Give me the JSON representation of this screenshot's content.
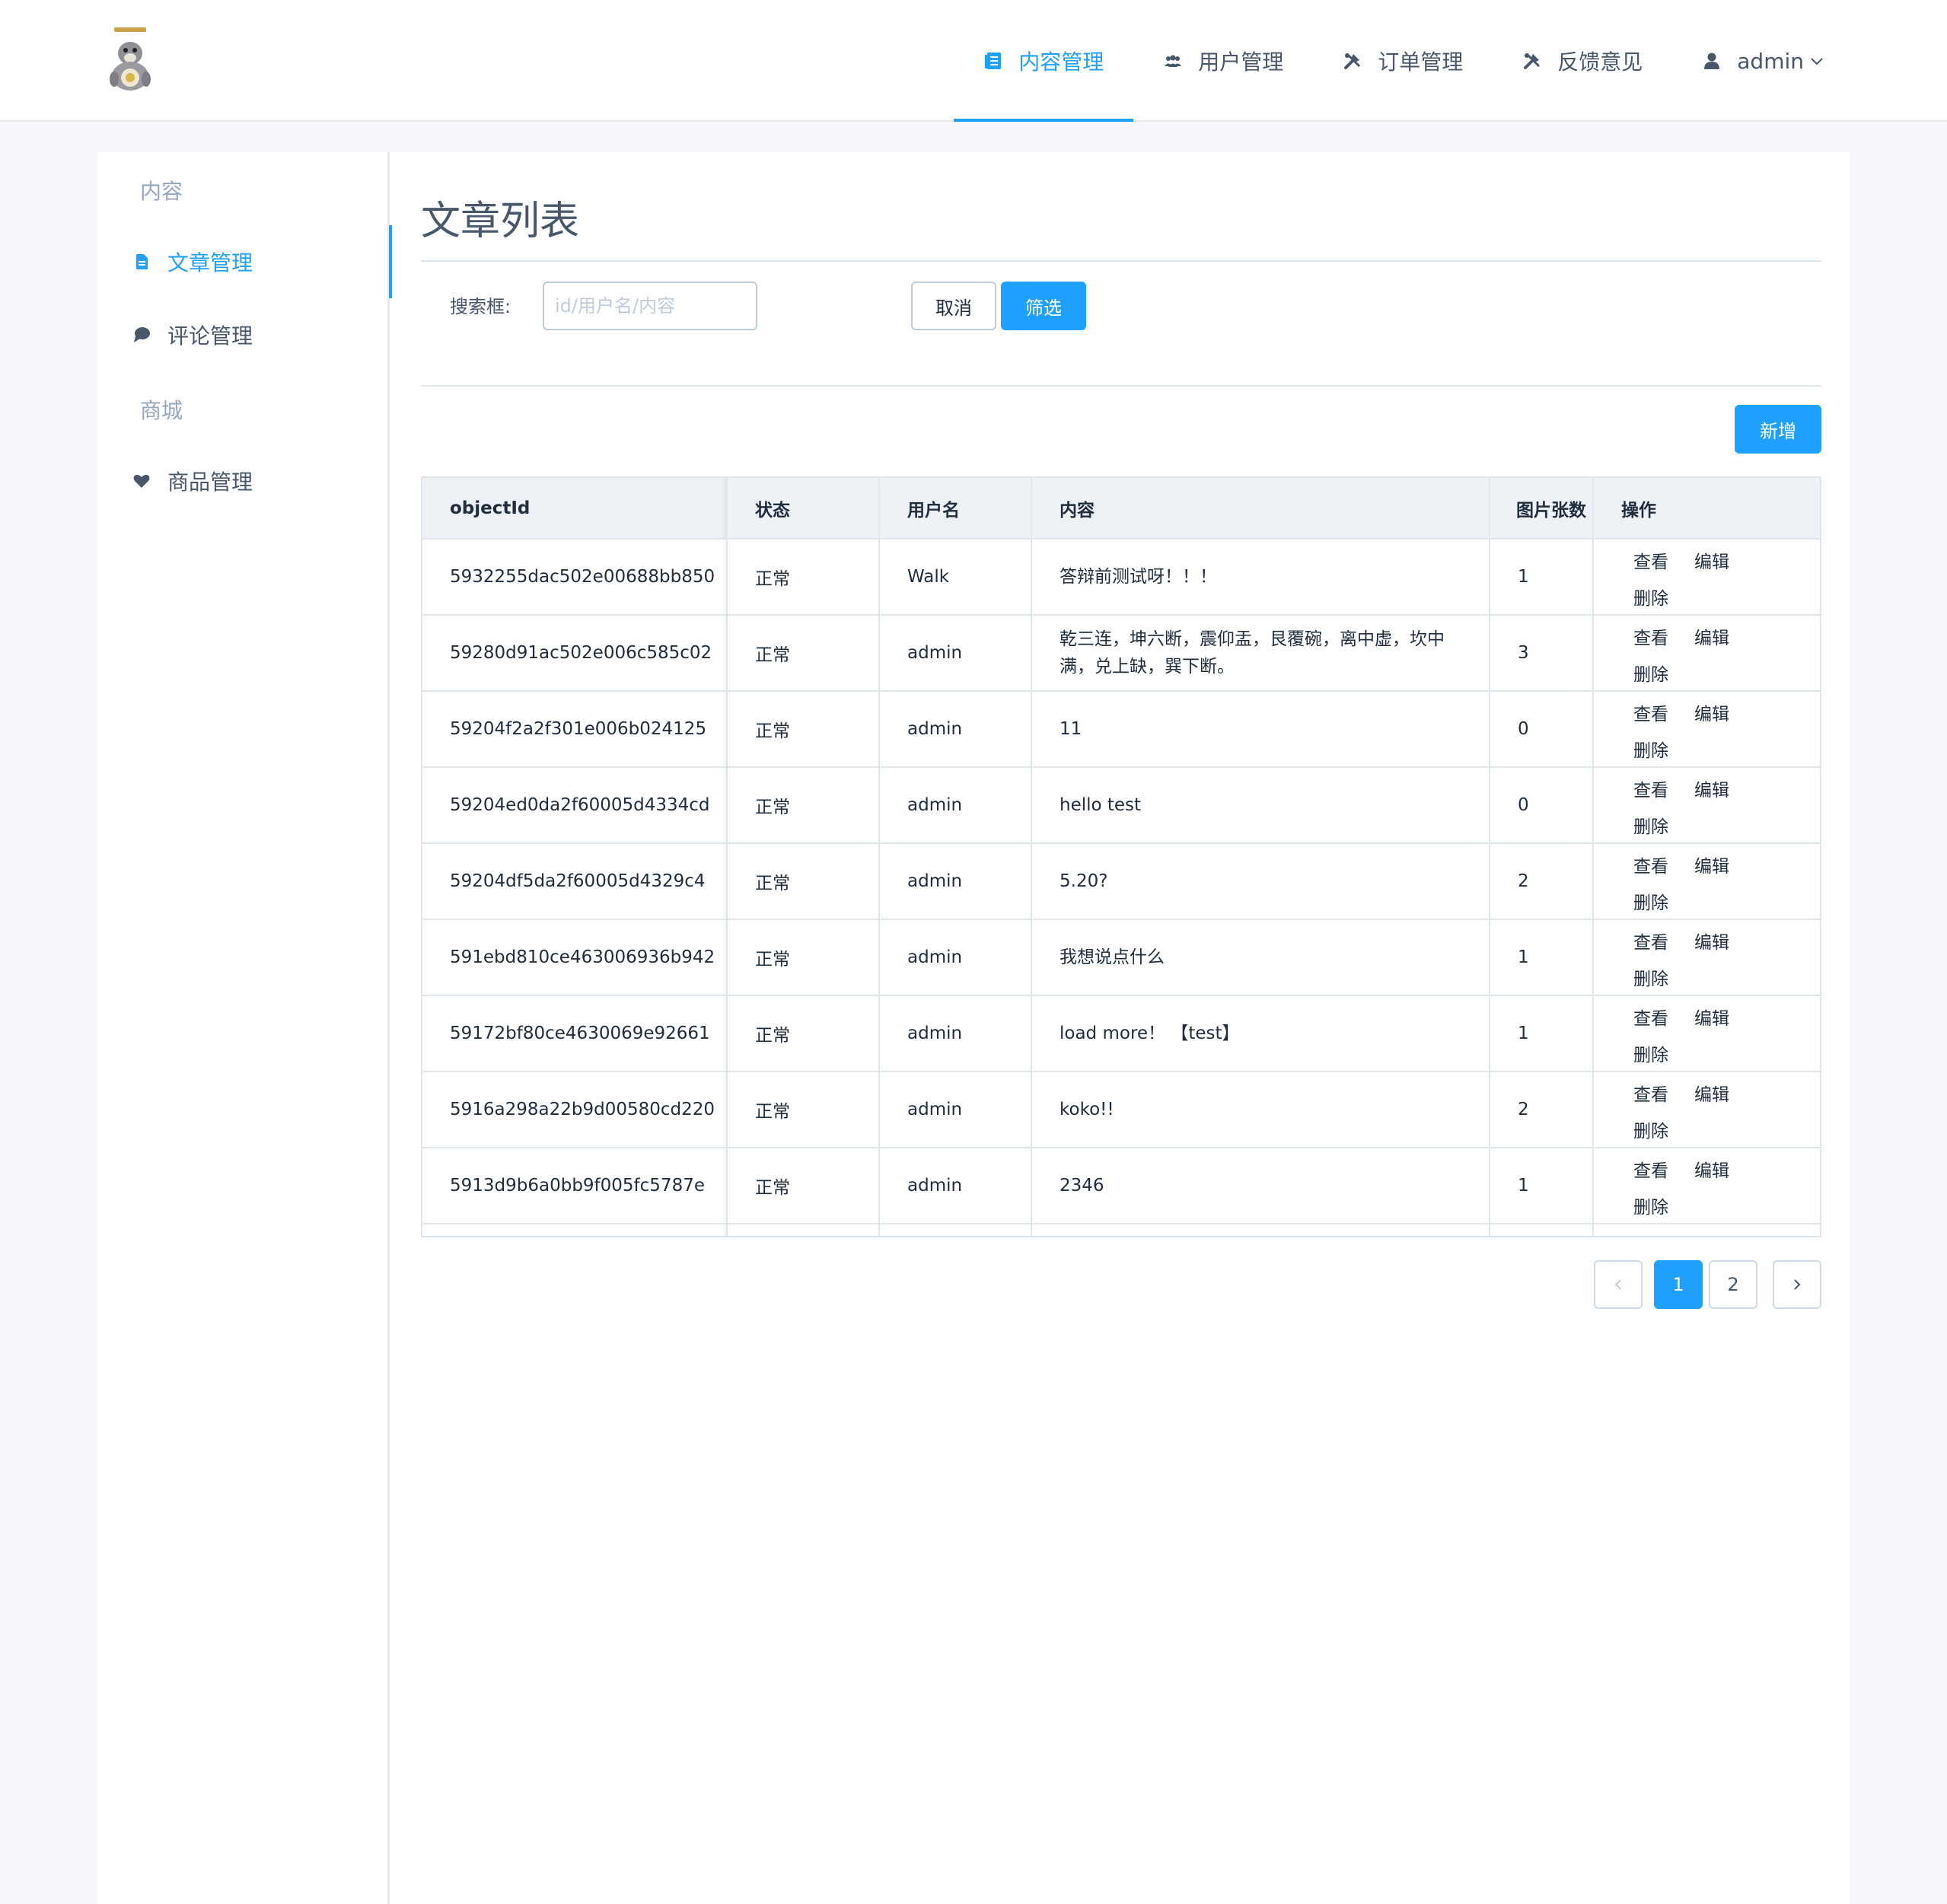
{
  "header": {
    "nav": [
      {
        "label": "内容管理",
        "icon": "list-icon",
        "active": true
      },
      {
        "label": "用户管理",
        "icon": "users-icon",
        "active": false
      },
      {
        "label": "订单管理",
        "icon": "tools-icon",
        "active": false
      },
      {
        "label": "反馈意见",
        "icon": "tools-icon",
        "active": false
      }
    ],
    "user": {
      "label": "admin",
      "icon": "user-icon"
    }
  },
  "sidebar": {
    "groups": [
      {
        "title": "内容",
        "items": [
          {
            "label": "文章管理",
            "icon": "document-icon",
            "active": true
          },
          {
            "label": "评论管理",
            "icon": "comment-icon",
            "active": false
          }
        ]
      },
      {
        "title": "商城",
        "items": [
          {
            "label": "商品管理",
            "icon": "heart-icon",
            "active": false
          }
        ]
      }
    ]
  },
  "main": {
    "title": "文章列表",
    "search": {
      "label": "搜索框:",
      "placeholder": "id/用户名/内容",
      "value": ""
    },
    "buttons": {
      "cancel": "取消",
      "filter": "筛选",
      "add": "新增"
    },
    "table": {
      "columns": [
        "objectId",
        "状态",
        "用户名",
        "内容",
        "图片张数",
        "操作"
      ],
      "actions": {
        "view": "查看",
        "edit": "编辑",
        "delete": "删除"
      },
      "rows": [
        {
          "id": "5932255dac502e00688bb850",
          "status": "正常",
          "user": "Walk",
          "content": "答辩前测试呀！！！",
          "images": "1"
        },
        {
          "id": "59280d91ac502e006c585c02",
          "status": "正常",
          "user": "admin",
          "content": "乾三连，坤六断，震仰盂，艮覆碗，离中虚，坎中满，兑上缺，巽下断。",
          "images": "3"
        },
        {
          "id": "59204f2a2f301e006b024125",
          "status": "正常",
          "user": "admin",
          "content": "11",
          "images": "0"
        },
        {
          "id": "59204ed0da2f60005d4334cd",
          "status": "正常",
          "user": "admin",
          "content": "hello test",
          "images": "0"
        },
        {
          "id": "59204df5da2f60005d4329c4",
          "status": "正常",
          "user": "admin",
          "content": "5.20?",
          "images": "2"
        },
        {
          "id": "591ebd810ce463006936b942",
          "status": "正常",
          "user": "admin",
          "content": "我想说点什么",
          "images": "1"
        },
        {
          "id": "59172bf80ce4630069e92661",
          "status": "正常",
          "user": "admin",
          "content": "load more！ 【test】",
          "images": "1"
        },
        {
          "id": "5916a298a22b9d00580cd220",
          "status": "正常",
          "user": "admin",
          "content": "koko!!",
          "images": "2"
        },
        {
          "id": "5913d9b6a0bb9f005fc5787e",
          "status": "正常",
          "user": "admin",
          "content": "2346",
          "images": "1"
        },
        {
          "id": "",
          "status": "",
          "user": "",
          "content": "",
          "images": ""
        }
      ]
    },
    "pagination": {
      "pages": [
        "1",
        "2"
      ],
      "current": "1",
      "prev_icon": "chevron-left-icon",
      "next_icon": "chevron-right-icon"
    }
  },
  "colors": {
    "accent": "#20a0ff",
    "text": "#48576a",
    "border": "#dfe6ec",
    "header_bg": "#eef1f6"
  }
}
